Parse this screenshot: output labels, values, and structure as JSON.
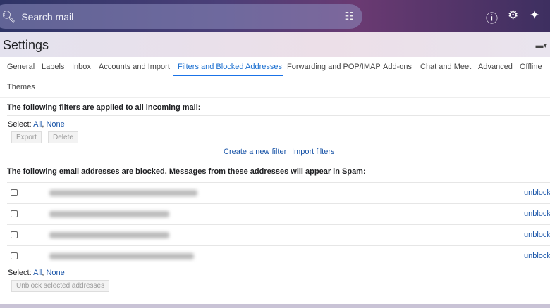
{
  "search": {
    "placeholder": "Search mail"
  },
  "icons": {
    "search": "search-icon",
    "tune": "tune-icon",
    "help": "help-icon",
    "settings": "gear-icon",
    "gemini": "sparkle-icon"
  },
  "page_title": "Settings",
  "tabs": [
    "General",
    "Labels",
    "Inbox",
    "Accounts and Import",
    "Filters and Blocked Addresses",
    "Forwarding and POP/IMAP",
    "Add-ons",
    "Chat and Meet",
    "Advanced",
    "Offline",
    "Themes"
  ],
  "filters": {
    "heading": "The following filters are applied to all incoming mail:",
    "select_label": "Select:",
    "all": "All",
    "none": "None",
    "export": "Export",
    "delete": "Delete",
    "create": "Create a new filter",
    "import": "Import filters"
  },
  "blocked": {
    "heading": "The following email addresses are blocked. Messages from these addresses will appear in Spam:",
    "rows": [
      {
        "unblock": "unblock"
      },
      {
        "unblock": "unblock"
      },
      {
        "unblock": "unblock"
      },
      {
        "unblock": "unblock"
      }
    ],
    "select_label": "Select:",
    "all": "All",
    "none": "None",
    "unblock_selected": "Unblock selected addresses"
  }
}
